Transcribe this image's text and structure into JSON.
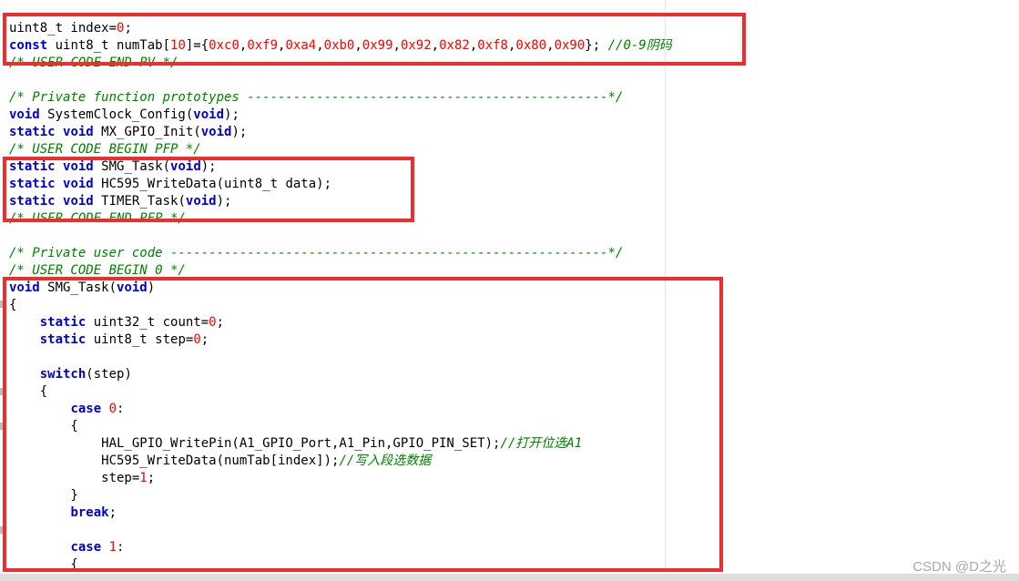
{
  "code_lines": [
    {
      "tokens": [
        {
          "t": "uint8_t index=",
          "c": "tx"
        },
        {
          "t": "0",
          "c": "num"
        },
        {
          "t": ";",
          "c": "tx"
        }
      ]
    },
    {
      "tokens": [
        {
          "t": "const",
          "c": "kw"
        },
        {
          "t": " uint8_t numTab[",
          "c": "tx"
        },
        {
          "t": "10",
          "c": "num"
        },
        {
          "t": "]={",
          "c": "tx"
        },
        {
          "t": "0xc0",
          "c": "num"
        },
        {
          "t": ",",
          "c": "tx"
        },
        {
          "t": "0xf9",
          "c": "num"
        },
        {
          "t": ",",
          "c": "tx"
        },
        {
          "t": "0xa4",
          "c": "num"
        },
        {
          "t": ",",
          "c": "tx"
        },
        {
          "t": "0xb0",
          "c": "num"
        },
        {
          "t": ",",
          "c": "tx"
        },
        {
          "t": "0x99",
          "c": "num"
        },
        {
          "t": ",",
          "c": "tx"
        },
        {
          "t": "0x92",
          "c": "num"
        },
        {
          "t": ",",
          "c": "tx"
        },
        {
          "t": "0x82",
          "c": "num"
        },
        {
          "t": ",",
          "c": "tx"
        },
        {
          "t": "0xf8",
          "c": "num"
        },
        {
          "t": ",",
          "c": "tx"
        },
        {
          "t": "0x80",
          "c": "num"
        },
        {
          "t": ",",
          "c": "tx"
        },
        {
          "t": "0x90",
          "c": "num"
        },
        {
          "t": "}; ",
          "c": "tx"
        },
        {
          "t": "//0-9阴码",
          "c": "cm"
        }
      ]
    },
    {
      "tokens": [
        {
          "t": "/* USER CODE END PV */",
          "c": "cm"
        }
      ]
    },
    {
      "tokens": []
    },
    {
      "tokens": [
        {
          "t": "/* Private function prototypes -----------------------------------------------*/",
          "c": "cm"
        }
      ]
    },
    {
      "tokens": [
        {
          "t": "void",
          "c": "kw"
        },
        {
          "t": " SystemClock_Config(",
          "c": "tx"
        },
        {
          "t": "void",
          "c": "kw"
        },
        {
          "t": ");",
          "c": "tx"
        }
      ]
    },
    {
      "tokens": [
        {
          "t": "static",
          "c": "kw"
        },
        {
          "t": " ",
          "c": "tx"
        },
        {
          "t": "void",
          "c": "kw"
        },
        {
          "t": " MX_GPIO_Init(",
          "c": "tx"
        },
        {
          "t": "void",
          "c": "kw"
        },
        {
          "t": ");",
          "c": "tx"
        }
      ]
    },
    {
      "tokens": [
        {
          "t": "/* USER CODE BEGIN PFP */",
          "c": "cm"
        }
      ]
    },
    {
      "tokens": [
        {
          "t": "static",
          "c": "kw"
        },
        {
          "t": " ",
          "c": "tx"
        },
        {
          "t": "void",
          "c": "kw"
        },
        {
          "t": " SMG_Task(",
          "c": "tx"
        },
        {
          "t": "void",
          "c": "kw"
        },
        {
          "t": ");",
          "c": "tx"
        }
      ]
    },
    {
      "tokens": [
        {
          "t": "static",
          "c": "kw"
        },
        {
          "t": " ",
          "c": "tx"
        },
        {
          "t": "void",
          "c": "kw"
        },
        {
          "t": " HC595_WriteData(uint8_t data);",
          "c": "tx"
        }
      ]
    },
    {
      "tokens": [
        {
          "t": "static",
          "c": "kw"
        },
        {
          "t": " ",
          "c": "tx"
        },
        {
          "t": "void",
          "c": "kw"
        },
        {
          "t": " TIMER_Task(",
          "c": "tx"
        },
        {
          "t": "void",
          "c": "kw"
        },
        {
          "t": ");",
          "c": "tx"
        }
      ]
    },
    {
      "tokens": [
        {
          "t": "/* USER CODE END PFP */",
          "c": "cm"
        }
      ]
    },
    {
      "tokens": []
    },
    {
      "tokens": [
        {
          "t": "/* Private user code ---------------------------------------------------------*/",
          "c": "cm"
        }
      ]
    },
    {
      "tokens": [
        {
          "t": "/* USER CODE BEGIN 0 */",
          "c": "cm"
        }
      ]
    },
    {
      "tokens": [
        {
          "t": "void",
          "c": "kw"
        },
        {
          "t": " SMG_Task(",
          "c": "tx"
        },
        {
          "t": "void",
          "c": "kw"
        },
        {
          "t": ")",
          "c": "tx"
        }
      ]
    },
    {
      "tokens": [
        {
          "t": "{",
          "c": "tx"
        }
      ]
    },
    {
      "tokens": [
        {
          "t": "    ",
          "c": "tx"
        },
        {
          "t": "static",
          "c": "kw"
        },
        {
          "t": " uint32_t count=",
          "c": "tx"
        },
        {
          "t": "0",
          "c": "num"
        },
        {
          "t": ";",
          "c": "tx"
        }
      ]
    },
    {
      "tokens": [
        {
          "t": "    ",
          "c": "tx"
        },
        {
          "t": "static",
          "c": "kw"
        },
        {
          "t": " uint8_t step=",
          "c": "tx"
        },
        {
          "t": "0",
          "c": "num"
        },
        {
          "t": ";",
          "c": "tx"
        }
      ]
    },
    {
      "tokens": []
    },
    {
      "tokens": [
        {
          "t": "    ",
          "c": "tx"
        },
        {
          "t": "switch",
          "c": "kw"
        },
        {
          "t": "(step)",
          "c": "tx"
        }
      ]
    },
    {
      "tokens": [
        {
          "t": "    {",
          "c": "tx"
        }
      ]
    },
    {
      "tokens": [
        {
          "t": "        ",
          "c": "tx"
        },
        {
          "t": "case",
          "c": "kw"
        },
        {
          "t": " ",
          "c": "tx"
        },
        {
          "t": "0",
          "c": "num"
        },
        {
          "t": ":",
          "c": "tx"
        }
      ]
    },
    {
      "tokens": [
        {
          "t": "        {",
          "c": "tx"
        }
      ]
    },
    {
      "tokens": [
        {
          "t": "            HAL_GPIO_WritePin(A1_GPIO_Port,A1_Pin,GPIO_PIN_SET);",
          "c": "tx"
        },
        {
          "t": "//打开位选A1",
          "c": "cm"
        }
      ]
    },
    {
      "tokens": [
        {
          "t": "            HC595_WriteData(numTab[index]);",
          "c": "tx"
        },
        {
          "t": "//写入段选数据",
          "c": "cm"
        }
      ]
    },
    {
      "tokens": [
        {
          "t": "            step=",
          "c": "tx"
        },
        {
          "t": "1",
          "c": "num"
        },
        {
          "t": ";",
          "c": "tx"
        }
      ]
    },
    {
      "tokens": [
        {
          "t": "        }",
          "c": "tx"
        }
      ]
    },
    {
      "tokens": [
        {
          "t": "        ",
          "c": "tx"
        },
        {
          "t": "break",
          "c": "kw"
        },
        {
          "t": ";",
          "c": "tx"
        }
      ]
    },
    {
      "tokens": []
    },
    {
      "tokens": [
        {
          "t": "        ",
          "c": "tx"
        },
        {
          "t": "case",
          "c": "kw"
        },
        {
          "t": " ",
          "c": "tx"
        },
        {
          "t": "1",
          "c": "num"
        },
        {
          "t": ":",
          "c": "tx"
        }
      ]
    },
    {
      "tokens": [
        {
          "t": "        {",
          "c": "tx"
        }
      ]
    }
  ],
  "watermark": "CSDN @D之光",
  "colors": {
    "keyword": "#0000cc",
    "number": "#ff0000",
    "comment": "#008000",
    "highlight_box": "#ee2e2e"
  }
}
